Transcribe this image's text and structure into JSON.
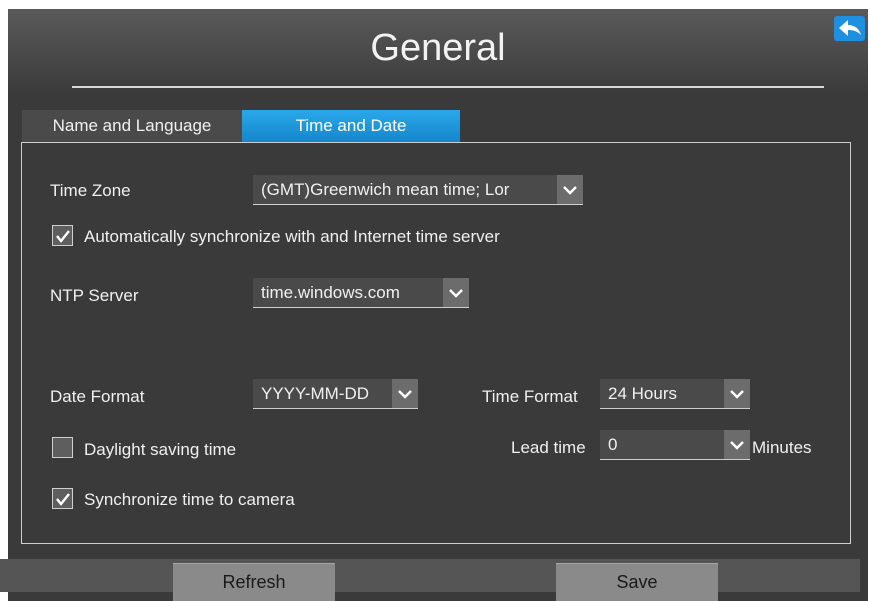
{
  "header": {
    "title": "General"
  },
  "tabs": [
    {
      "label": "Name and Language",
      "active": false
    },
    {
      "label": "Time and Date",
      "active": true
    }
  ],
  "form": {
    "time_zone": {
      "label": "Time Zone",
      "value": "(GMT)Greenwich mean time; Lor"
    },
    "auto_sync": {
      "label": "Automatically synchronize with and Internet time server",
      "checked": true
    },
    "ntp_server": {
      "label": "NTP Server",
      "value": "time.windows.com"
    },
    "date_format": {
      "label": "Date Format",
      "value": "YYYY-MM-DD"
    },
    "time_format": {
      "label": "Time Format",
      "value": "24 Hours"
    },
    "daylight_saving": {
      "label": "Daylight saving time",
      "checked": false
    },
    "lead_time": {
      "label": "Lead time",
      "value": "0",
      "unit": "Minutes"
    },
    "sync_camera": {
      "label": "Synchronize time to camera",
      "checked": true
    }
  },
  "buttons": {
    "refresh": "Refresh",
    "save": "Save"
  },
  "colors": {
    "accent": "#1f8fe0",
    "panel": "#3a3a3a",
    "active_tab": "#1686cc"
  },
  "icons": {
    "back": "back-arrow-icon",
    "dropdown": "chevron-down-icon",
    "check": "checkmark-icon"
  }
}
